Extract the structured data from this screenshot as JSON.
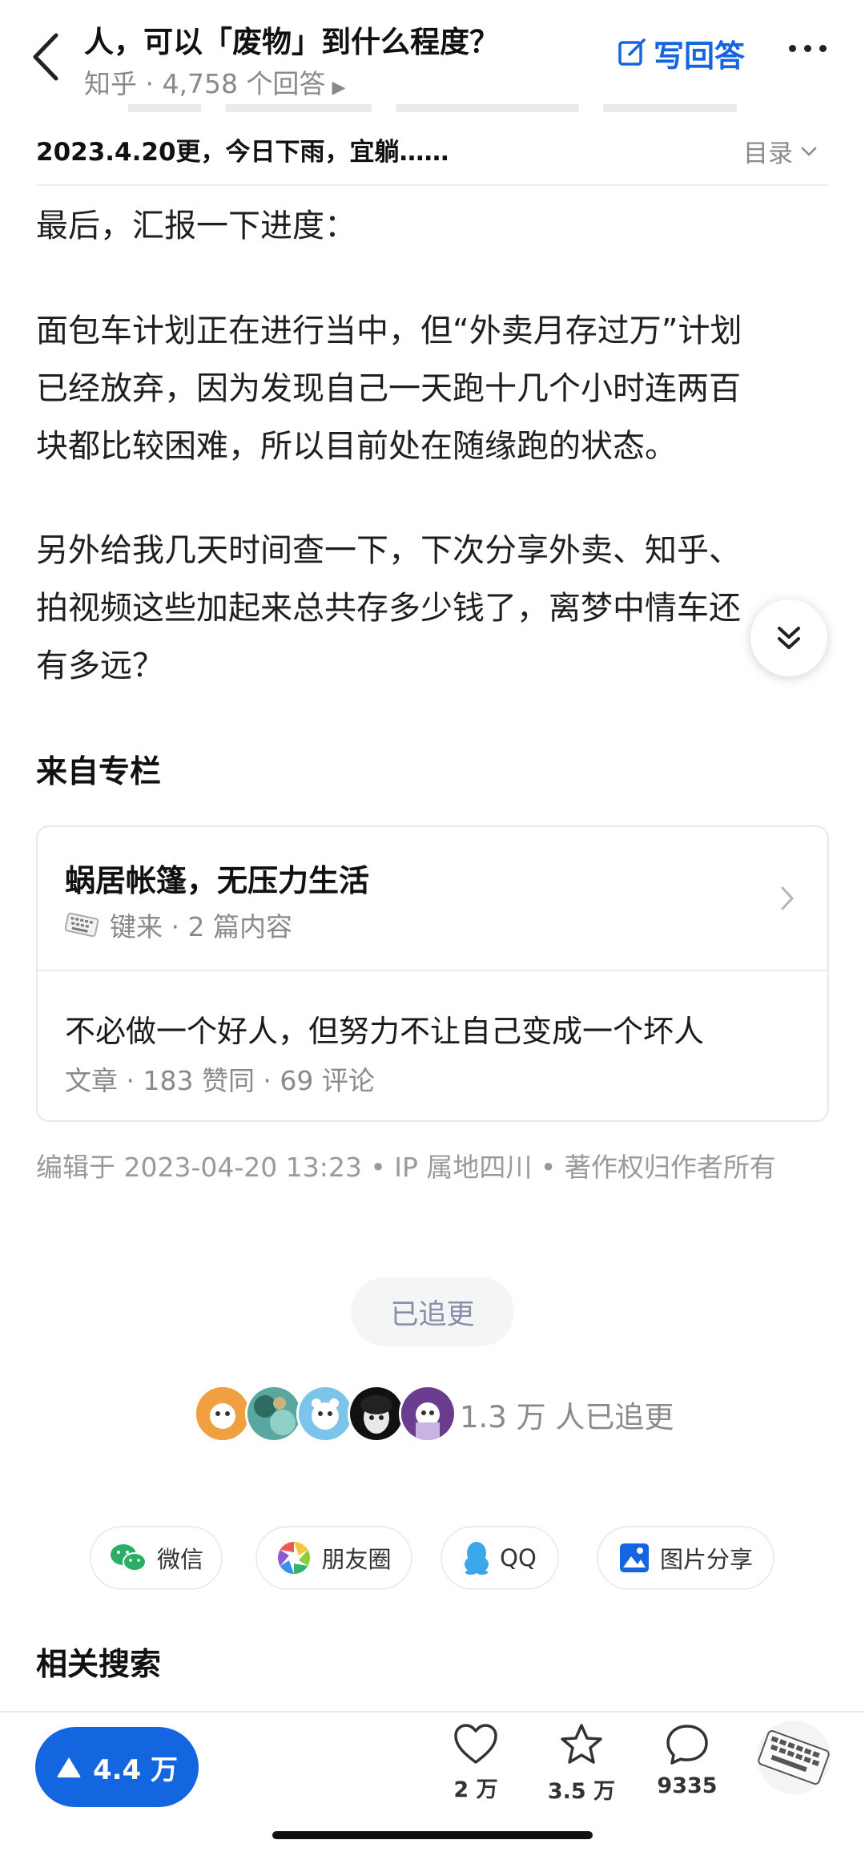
{
  "header": {
    "title": "人，可以「废物」到什么程度？",
    "subtitle": "知乎 · 4,758 个回答",
    "write_answer": "写回答"
  },
  "toc": {
    "text": "2023.4.20更，今日下雨，宜躺……",
    "button": "目录"
  },
  "content": {
    "p1": "最后，汇报一下进度：",
    "p2_l1": "面包车计划正在进行当中，但“外卖月存过万”计划",
    "p2_l2": "已经放弃，因为发现自己一天跑十几个小时连两百",
    "p2_l3": "块都比较困难，所以目前处在随缘跑的状态。",
    "p3_l1": "另外给我几天时间查一下，下次分享外卖、知乎、",
    "p3_l2": "拍视频这些加起来总共存多少钱了，离梦中情车还",
    "p3_l3": "有多远？"
  },
  "column": {
    "section_title": "来自专栏",
    "name": "蜗居帐篷，无压力生活",
    "meta": "键来 · 2 篇内容",
    "article_title": "不必做一个好人，但努力不让自己变成一个坏人",
    "article_meta": "文章 · 183 赞同 · 69 评论"
  },
  "edit_info": "编辑于 2023-04-20 13:23 • IP 属地四川 • 著作权归作者所有",
  "follow": {
    "button": "已追更",
    "count_text": "1.3 万 人已追更"
  },
  "share": {
    "wechat": "微信",
    "moments": "朋友圈",
    "qq": "QQ",
    "image": "图片分享"
  },
  "related": {
    "title": "相关搜索"
  },
  "bottom": {
    "vote_count": "4.4 万",
    "like_count": "2 万",
    "favorite_count": "3.5 万",
    "comment_count": "9335"
  },
  "colors": {
    "accent": "#1466e0",
    "muted": "#8a8a8a",
    "wechat_green": "#2aae67",
    "qq_blue": "#3ba7e8"
  },
  "icons": {
    "back": "chevron-left-icon",
    "write": "edit-icon",
    "more": "more-dots-icon",
    "toc": "chevron-down-icon",
    "float": "double-chevron-down-icon",
    "vote": "triangle-up-icon",
    "like": "heart-icon",
    "favorite": "star-icon",
    "comment": "comment-bubble-icon"
  }
}
